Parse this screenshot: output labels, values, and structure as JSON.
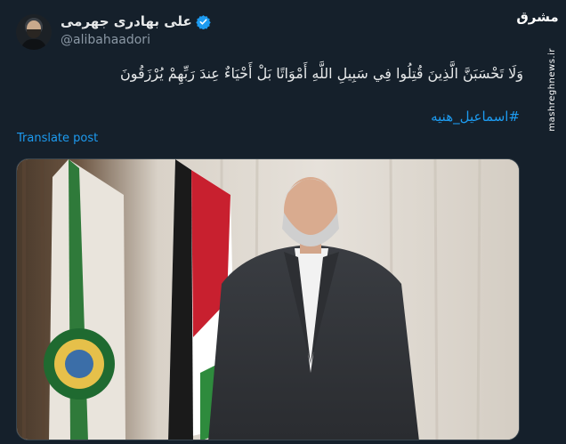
{
  "author": {
    "display_name": "علی بهادری جهرمی",
    "handle": "@alibahaadori",
    "verified": true
  },
  "watermark": {
    "logo_text": "مشرق",
    "site_text": "mashreghnews.ir"
  },
  "tweet": {
    "text": "وَلَا تَحْسَبَنَّ الَّذِينَ قُتِلُوا فِي سَبِيلِ اللَّهِ أَمْوَاتًا بَلْ أَحْيَاءٌ عِندَ رَبِّهِمْ يُرْزَقُونَ",
    "hashtag": "#اسماعیل_هنیه",
    "translate_label": "Translate post"
  },
  "colors": {
    "background": "#15202b",
    "link": "#1d9bf0",
    "secondary_text": "#8b98a5",
    "verified_badge": "#1d9bf0"
  },
  "icons": {
    "verified": "verified-badge-icon"
  }
}
